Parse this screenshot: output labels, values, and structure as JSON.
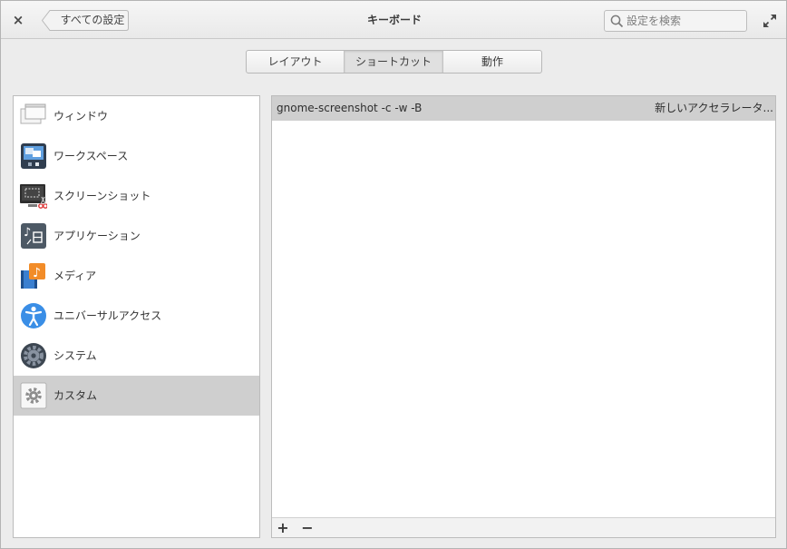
{
  "header": {
    "close_label": "×",
    "back_label": "すべての設定",
    "title": "キーボード",
    "search_placeholder": "設定を検索"
  },
  "tabs": [
    {
      "label": "レイアウト",
      "active": false
    },
    {
      "label": "ショートカット",
      "active": true
    },
    {
      "label": "動作",
      "active": false
    }
  ],
  "sidebar": {
    "items": [
      {
        "label": "ウィンドウ",
        "icon": "window-icon"
      },
      {
        "label": "ワークスペース",
        "icon": "workspace-icon"
      },
      {
        "label": "スクリーンショット",
        "icon": "screenshot-icon"
      },
      {
        "label": "アプリケーション",
        "icon": "application-icon"
      },
      {
        "label": "メディア",
        "icon": "media-icon"
      },
      {
        "label": "ユニバーサルアクセス",
        "icon": "universal-access-icon"
      },
      {
        "label": "システム",
        "icon": "system-gear-icon"
      },
      {
        "label": "カスタム",
        "icon": "custom-gear-icon",
        "selected": true
      }
    ]
  },
  "shortcuts": {
    "rows": [
      {
        "command": "gnome-screenshot -c -w -B",
        "accelerator": "新しいアクセラレータ..."
      }
    ],
    "add_label": "+",
    "remove_label": "−"
  },
  "colors": {
    "selection": "#cfcfcf",
    "accent_blue": "#3a8ee6",
    "media_orange": "#f28c28"
  }
}
